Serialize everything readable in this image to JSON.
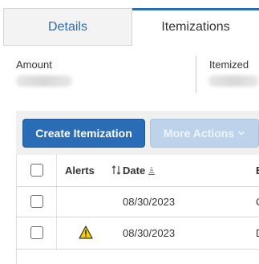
{
  "tabs": [
    {
      "label": "Details",
      "active": false
    },
    {
      "label": "Itemizations",
      "active": true
    }
  ],
  "summary": {
    "amount_label": "Amount",
    "itemized_label": "Itemized"
  },
  "toolbar": {
    "create_label": "Create Itemization",
    "more_actions_label": "More Actions",
    "more_actions_icon": "chevron-down-icon"
  },
  "table": {
    "columns": {
      "alerts": "Alerts",
      "date": "Date",
      "next_col_truncated": "E"
    },
    "rows": [
      {
        "alert": "",
        "date": "08/30/2023",
        "next_col_truncated": "C"
      },
      {
        "alert": "warning-icon",
        "date": "08/30/2023",
        "next_col_truncated": "D"
      }
    ]
  },
  "colors": {
    "primary": "#2a6cb5",
    "primary_disabled": "#bcd3ea",
    "toolbar_bg": "#f0f0f0",
    "tab_inactive_bg": "#f3f3f3",
    "warning": "#f5d000"
  }
}
